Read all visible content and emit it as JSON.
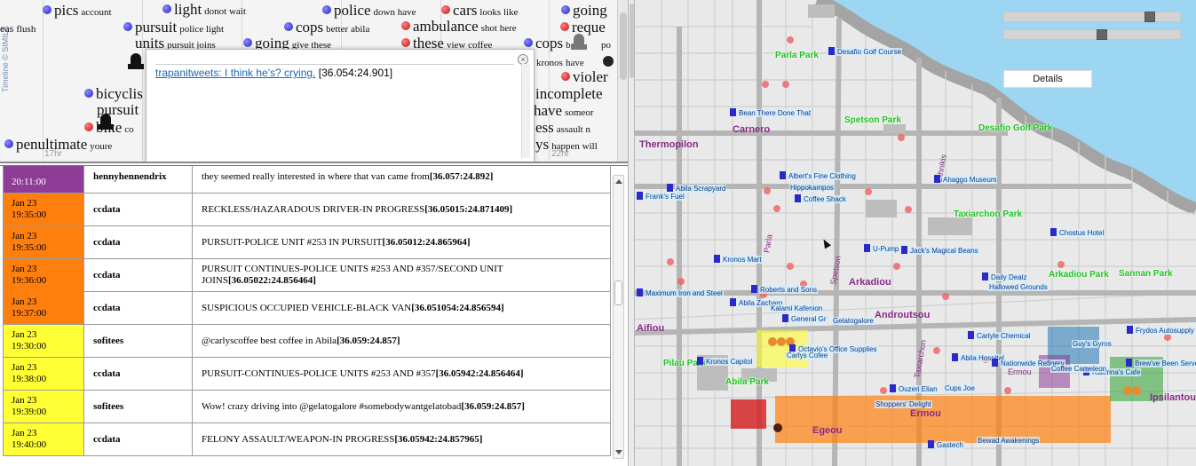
{
  "timeline": {
    "credit": "Timeline © SIMILE",
    "ticks": [
      "17hr",
      "22hr"
    ],
    "words": [
      {
        "text": "pics",
        "small": "account",
        "dot": "blue"
      },
      {
        "text": "light",
        "small": "donot  wait",
        "dot": "blue"
      },
      {
        "text": "police",
        "small": "down  have",
        "dot": "blue"
      },
      {
        "text": "cars",
        "small": "looks  like",
        "dot": "red"
      },
      {
        "text": "going",
        "small": "",
        "dot": "blue"
      },
      {
        "text": "eas",
        "small": "flush",
        "dot": ""
      },
      {
        "text": "pursuit",
        "small": "police  light",
        "dot": "blue"
      },
      {
        "text": "cops",
        "small": "better  abila",
        "dot": "blue"
      },
      {
        "text": "ambulance",
        "small": "shot  here",
        "dot": "red"
      },
      {
        "text": "reque",
        "small": "",
        "dot": "red"
      },
      {
        "text": "units",
        "small": "pursuit  joins",
        "dot": ""
      },
      {
        "text": "going",
        "small": "give  these",
        "dot": "blue"
      },
      {
        "text": "these",
        "small": "view  coffee",
        "dot": "red"
      },
      {
        "text": "cops",
        "small": "back",
        "dot": "blue"
      },
      {
        "text": "po",
        "small": "",
        "dot": ""
      },
      {
        "text": "kronos",
        "small": "have",
        "dot": "red"
      },
      {
        "text": "violer",
        "small": "",
        "dot": "red"
      },
      {
        "text": "bicyclis",
        "small": "",
        "dot": "blue"
      },
      {
        "text": "incomplete",
        "small": "",
        "dot": "blue"
      },
      {
        "text": "pursuit",
        "small": "",
        "dot": ""
      },
      {
        "text": "have",
        "small": "someor",
        "dot": "blue"
      },
      {
        "text": "bike",
        "small": "co",
        "dot": "red"
      },
      {
        "text": "ess",
        "small": "assault  n",
        "dot": ""
      },
      {
        "text": "penultimate",
        "small": "youre",
        "dot": "blue"
      },
      {
        "text": "ys",
        "small": "happen  will",
        "dot": ""
      }
    ],
    "bubble": {
      "link": "trapanitweets: I think he's? crying.",
      "coord": "[36.054:24.901]",
      "close_icon": "close-icon"
    }
  },
  "messages": {
    "rows": [
      {
        "date": "",
        "time": "20:11:00",
        "user": "hennyhennendrix",
        "text": "they seemed really interested in where that van came from",
        "coord": "[36.057:24.892]",
        "color": "#8e3d96"
      },
      {
        "date": "Jan 23",
        "time": "19:35:00",
        "user": "ccdata",
        "text": "RECKLESS/HAZARADOUS DRIVER-IN PROGRESS",
        "coord": "[36.05015:24.871409]",
        "color": "#ff7f0e"
      },
      {
        "date": "Jan 23",
        "time": "19:35:00",
        "user": "ccdata",
        "text": "PURSUIT-POLICE UNIT #253 IN PURSUIT",
        "coord": "[36.05012:24.865964]",
        "color": "#ff7f0e"
      },
      {
        "date": "Jan 23",
        "time": "19:36:00",
        "user": "ccdata",
        "text": "PURSUIT CONTINUES-POLICE UNITS #253 AND #357/SECOND UNIT JOINS",
        "coord": "[36.05022:24.856464]",
        "color": "#ff7f0e"
      },
      {
        "date": "Jan 23",
        "time": "19:37:00",
        "user": "ccdata",
        "text": "SUSPICIOUS OCCUPIED VEHICLE-BLACK VAN",
        "coord": "[36.051054:24.856594]",
        "color": "#ff7f0e"
      },
      {
        "date": "Jan 23",
        "time": "19:30:00",
        "user": "sofitees",
        "text": "@carlyscoffee best coffee in Abila",
        "coord": "[36.059:24.857]",
        "color": "#ffff33"
      },
      {
        "date": "Jan 23",
        "time": "19:38:00",
        "user": "ccdata",
        "text": "PURSUIT-CONTINUES-POLICE UNITS #253 AND #357",
        "coord": "[36.05942:24.856464]",
        "color": "#ffff33"
      },
      {
        "date": "Jan 23",
        "time": "19:39:00",
        "user": "sofitees",
        "text": "Wow! crazy driving into @gelatogalore #somebodywantgelatobad",
        "coord": "[36.059:24.857]",
        "color": "#ffff33"
      },
      {
        "date": "Jan 23",
        "time": "19:40:00",
        "user": "ccdata",
        "text": "FELONY ASSAULT/WEAPON-IN PROGRESS",
        "coord": "[36.05942:24.857965]",
        "color": "#ffff33"
      }
    ]
  },
  "map": {
    "details_label": "Details",
    "parks": [
      "Parla Park",
      "Spetson Park",
      "Desafio Golf Park",
      "Taxiarchon Park",
      "Arkadiou Park",
      "Sannan Park",
      "Pilau Park",
      "Abila Park"
    ],
    "districts": [
      "Carnero",
      "Thermopilon",
      "Arkadiou",
      "Androutsou",
      "Ermou",
      "Egeou",
      "Ipsilantou",
      "Aifiou",
      "Parla",
      "Spetson",
      "Taxiarchon",
      "Ethnikis",
      "Ermou"
    ],
    "pois": [
      "Desafio Golf Course",
      "Bean There Done That",
      "Frank's Fuel",
      "Abila Scrapyard",
      "Albert's Fine Clothing",
      "Hippokampos",
      "Coffee Shack",
      "Ahaggo Museum",
      "Chostus Hotel",
      "U-Pump",
      "Jack's Magical Beans",
      "Kronos Mart",
      "Maximum Iron and Steel",
      "Roberts and Sons",
      "Abila Zacharo",
      "Kalami Kafenion",
      "General Gr",
      "Gelatogalore",
      "Daily Dealz",
      "Hallowed Grounds",
      "Carlyle Chemical",
      "Guy's Gyros",
      "Frydos Autosupply",
      "Octavio's Office Supplies",
      "Carlys Cofee",
      "Abila Hospital",
      "Nationwide Refinery",
      "Katerina's Cafe",
      "Brew've Been Served",
      "Kronos Capitol",
      "Ouzeri Elian",
      "Cups Joe",
      "Shoppers' Delight",
      "Gastech",
      "Bewad Awakenings",
      "Coffee Cameleon"
    ]
  },
  "colors": {
    "orange": "#ff7f0e",
    "yellow": "#ffff33",
    "purple": "#8e3d96",
    "red_block": "#d62728",
    "green_block": "#2ca02c",
    "blue_block": "#1f77b4"
  }
}
